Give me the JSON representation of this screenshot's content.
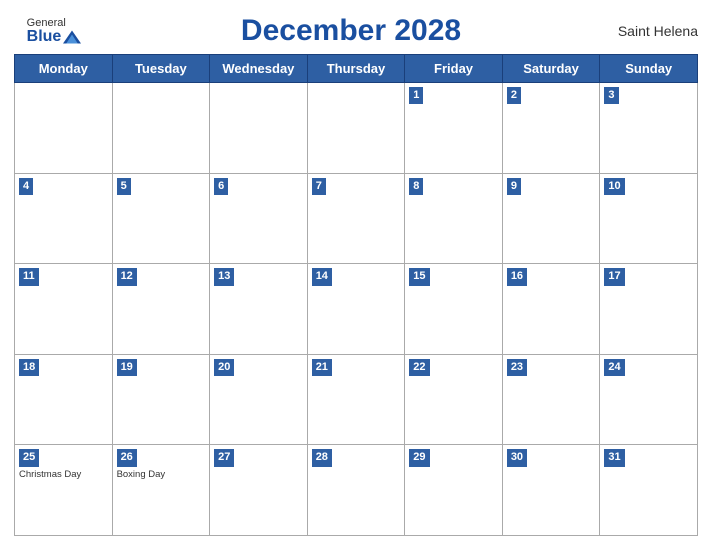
{
  "header": {
    "logo": {
      "general": "General",
      "blue": "Blue",
      "icon_alt": "GeneralBlue logo"
    },
    "title": "December 2028",
    "region": "Saint Helena"
  },
  "days_of_week": [
    "Monday",
    "Tuesday",
    "Wednesday",
    "Thursday",
    "Friday",
    "Saturday",
    "Sunday"
  ],
  "weeks": [
    [
      {
        "day": "",
        "empty": true
      },
      {
        "day": "",
        "empty": true
      },
      {
        "day": "",
        "empty": true
      },
      {
        "day": "",
        "empty": true
      },
      {
        "day": "1",
        "events": []
      },
      {
        "day": "2",
        "events": []
      },
      {
        "day": "3",
        "events": []
      }
    ],
    [
      {
        "day": "4",
        "events": []
      },
      {
        "day": "5",
        "events": []
      },
      {
        "day": "6",
        "events": []
      },
      {
        "day": "7",
        "events": []
      },
      {
        "day": "8",
        "events": []
      },
      {
        "day": "9",
        "events": []
      },
      {
        "day": "10",
        "events": []
      }
    ],
    [
      {
        "day": "11",
        "events": []
      },
      {
        "day": "12",
        "events": []
      },
      {
        "day": "13",
        "events": []
      },
      {
        "day": "14",
        "events": []
      },
      {
        "day": "15",
        "events": []
      },
      {
        "day": "16",
        "events": []
      },
      {
        "day": "17",
        "events": []
      }
    ],
    [
      {
        "day": "18",
        "events": []
      },
      {
        "day": "19",
        "events": []
      },
      {
        "day": "20",
        "events": []
      },
      {
        "day": "21",
        "events": []
      },
      {
        "day": "22",
        "events": []
      },
      {
        "day": "23",
        "events": []
      },
      {
        "day": "24",
        "events": []
      }
    ],
    [
      {
        "day": "25",
        "events": [
          "Christmas Day"
        ]
      },
      {
        "day": "26",
        "events": [
          "Boxing Day"
        ]
      },
      {
        "day": "27",
        "events": []
      },
      {
        "day": "28",
        "events": []
      },
      {
        "day": "29",
        "events": []
      },
      {
        "day": "30",
        "events": []
      },
      {
        "day": "31",
        "events": []
      }
    ]
  ],
  "colors": {
    "header_bg": "#2e5fa3",
    "accent": "#1a4fa0"
  }
}
